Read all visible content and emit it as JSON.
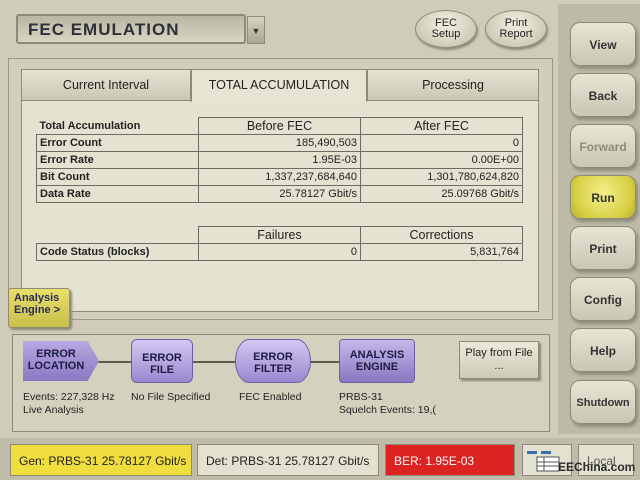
{
  "window": {
    "title": "FEC EMULATION",
    "title_dropdown": "▼"
  },
  "header_buttons": {
    "fec_setup": "FEC Setup",
    "print_report": "Print Report"
  },
  "side_buttons": [
    {
      "label": "View",
      "state": "normal"
    },
    {
      "label": "Back",
      "state": "normal"
    },
    {
      "label": "Forward",
      "state": "disabled"
    },
    {
      "label": "Run",
      "state": "active"
    },
    {
      "label": "Print",
      "state": "normal"
    },
    {
      "label": "Config",
      "state": "normal"
    },
    {
      "label": "Help",
      "state": "normal"
    },
    {
      "label": "Shutdown",
      "state": "normal"
    }
  ],
  "tabs": {
    "current_interval": "Current Interval",
    "total_accumulation": "TOTAL ACCUMULATION",
    "processing": "Processing",
    "active": "TOTAL ACCUMULATION"
  },
  "accumulation": {
    "section": "Total Accumulation",
    "col_before": "Before FEC",
    "col_after": "After FEC",
    "rows": [
      {
        "label": "Error Count",
        "before": "185,490,503",
        "after": "0"
      },
      {
        "label": "Error Rate",
        "before": "1.95E-03",
        "after": "0.00E+00"
      },
      {
        "label": "Bit Count",
        "before": "1,337,237,684,640",
        "after": "1,301,780,624,820"
      },
      {
        "label": "Data Rate",
        "before": "25.78127 Gbit/s",
        "after": "25.09768 Gbit/s"
      }
    ]
  },
  "code_status": {
    "col_failures": "Failures",
    "col_corrections": "Corrections",
    "label": "Code Status (blocks)",
    "failures": "0",
    "corrections": "5,831,764"
  },
  "analysis_engine_tab": "Analysis Engine >",
  "flow": {
    "error_location": {
      "label": "ERROR LOCATION",
      "caption1": "Events: 227,328 Hz",
      "caption2": "Live Analysis"
    },
    "error_file": {
      "label": "ERROR FILE",
      "caption1": "No File Specified"
    },
    "error_filter": {
      "label": "ERROR FILTER",
      "caption1": "FEC Enabled"
    },
    "analysis_engine": {
      "label": "ANALYSIS ENGINE",
      "caption1": "PRBS-31",
      "caption2": "Squelch Events: 19,("
    },
    "play_button": "Play from File ..."
  },
  "status": {
    "gen": "Gen: PRBS-31 25.78127 Gbit/s",
    "det": "Det: PRBS-31 25.78127 Gbit/s",
    "ber": "BER: 1.95E-03",
    "local": "Local",
    "watermark": "EEChina.com"
  }
}
